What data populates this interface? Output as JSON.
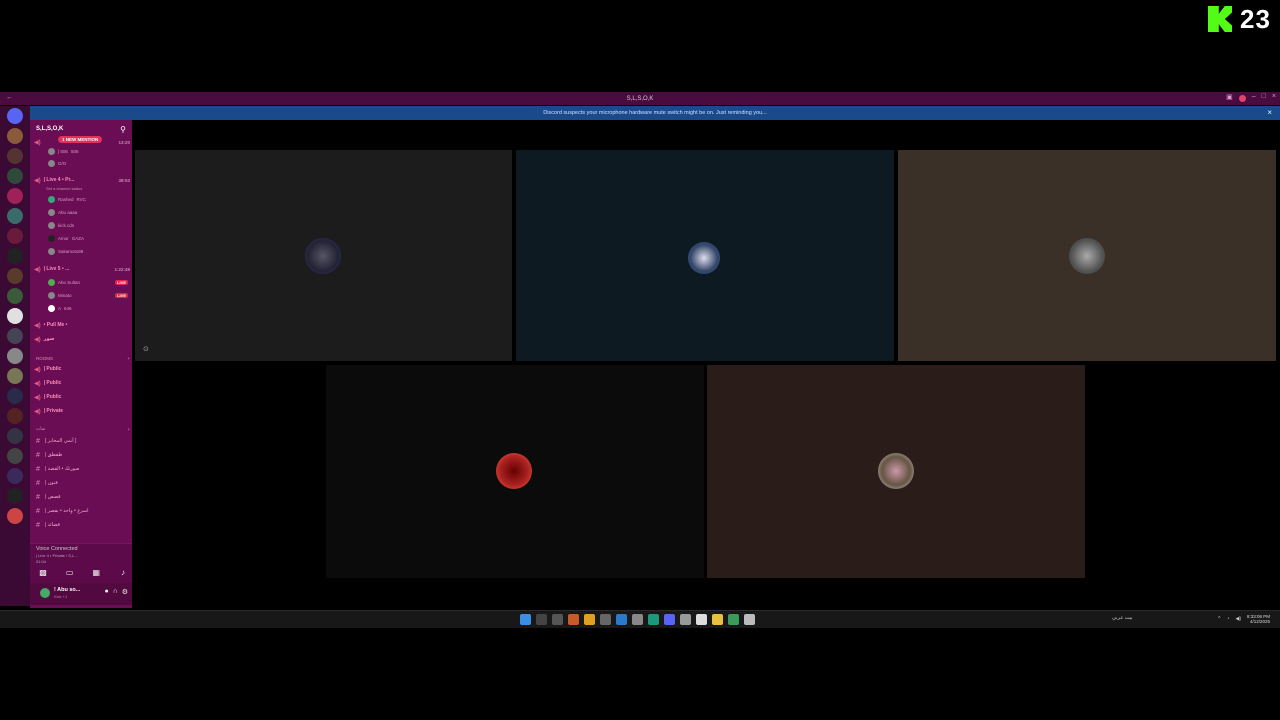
{
  "overlay": {
    "viewer_count": "23",
    "kick_logo": "K"
  },
  "window": {
    "title": "S,L,S,O,K",
    "banner_text": "Discord suspects your microphone hardware mute switch might be on. Just reminding you..."
  },
  "server": {
    "name": "S,L,S,O,K",
    "mention_pill": "1 NEW MENTION"
  },
  "voice_channels": [
    {
      "label": "",
      "time": "13:20",
      "members": [
        {
          "name": "| 506",
          "tag": "506"
        },
        {
          "name": "G/O",
          "tag": ""
        }
      ]
    },
    {
      "label": "| Live 4 • Pr...",
      "time": "38:53",
      "status": "Set a channel status",
      "members": [
        {
          "name": "Rashed",
          "tag": "RVC"
        },
        {
          "name": "Abu aaaa",
          "tag": ""
        },
        {
          "name": "kick.cdn",
          "tag": ""
        },
        {
          "name": "Amor",
          "tag": "GAZA"
        },
        {
          "name": "Sakamoto99",
          "tag": ""
        }
      ]
    },
    {
      "label": "| Live 5 • ...",
      "time": "1:22:49",
      "members": [
        {
          "name": "Abo Sultan",
          "tag": "LIVE"
        },
        {
          "name": "Minato",
          "tag": "LIVE"
        },
        {
          "name": "A",
          "tag": "646"
        }
      ]
    },
    {
      "label": "• Pull Me •",
      "time": "",
      "members": []
    },
    {
      "label": "صور",
      "time": "",
      "members": []
    }
  ],
  "rooms_section": "ROOMS",
  "rooms": [
    "| Public",
    "| Public",
    "| Public",
    "| Private"
  ],
  "text_section": "شات",
  "text_channels": [
    "[ أنمي المخابز ]",
    "| طقطق",
    "| صورتك • القصة",
    "| فنون",
    "| قصص",
    "| اسرع • واحد • يقصر",
    "| قصائد"
  ],
  "voice_panel": {
    "connected": "Voice Connected",
    "channel": "| Live 4 • Private / S,L...",
    "latency": "01:04"
  },
  "user": {
    "name": "! Abu so...",
    "status": "Kick +1"
  },
  "tiles": [
    {
      "name": "tile-1",
      "color": "#1c1c1c"
    },
    {
      "name": "tile-2",
      "color": "#0d1a22"
    },
    {
      "name": "tile-3",
      "color": "#3a3028"
    },
    {
      "name": "tile-4",
      "color": "#0b0b0b"
    },
    {
      "name": "tile-5",
      "color": "#2a1c18"
    }
  ],
  "taskbar": {
    "lang": "بيت عربي",
    "time": "8:33:06 PM",
    "date": "4/12/2025"
  },
  "colors": {
    "accent": "#e0315c",
    "sidebar": "#6a0d54",
    "titlebar": "#4a0b3e",
    "banner": "#1a4a8a",
    "kick_green": "#53fc18"
  }
}
